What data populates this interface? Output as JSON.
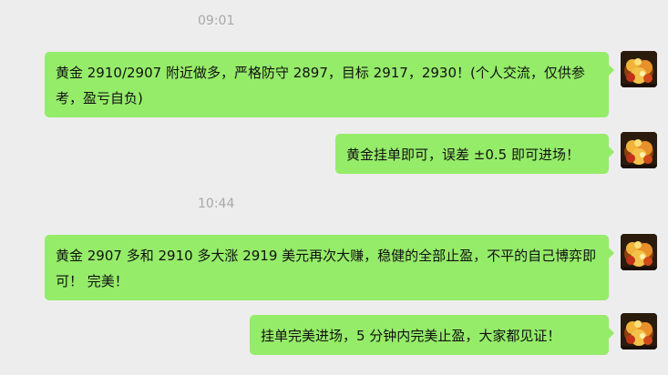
{
  "messages": [
    {
      "time": "09:01",
      "text": "黄金 2910/2907 附近做多，严格防守 2897，目标 2917，2930！(个人交流，仅供参考，盈亏自负)",
      "avatar": "sender-avatar"
    },
    {
      "text": "黄金挂单即可，误差 ±0.5 即可进场！",
      "avatar": "sender-avatar"
    },
    {
      "time": "10:44",
      "text": "黄金 2907 多和 2910 多大涨 2919 美元再次大赚，稳健的全部止盈，不平的自己博弈即可！ 完美！",
      "avatar": "sender-avatar"
    },
    {
      "text": "挂单完美进场，5 分钟内完美止盈，大家都见证！",
      "avatar": "sender-avatar"
    }
  ],
  "colors": {
    "background": "#ededed",
    "bubble": "#95ec69",
    "timestamp": "#a8a8a8",
    "text": "#111111"
  }
}
